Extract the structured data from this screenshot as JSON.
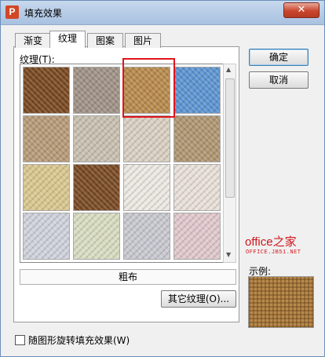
{
  "window": {
    "title": "填充效果",
    "close_glyph": "✕",
    "app_icon_letter": "P"
  },
  "tabs": [
    {
      "label": "渐变",
      "active": false
    },
    {
      "label": "纹理",
      "active": true
    },
    {
      "label": "图案",
      "active": false
    },
    {
      "label": "图片",
      "active": false
    }
  ],
  "texture_section": {
    "label": "纹理(T):",
    "selected_index": 2,
    "selected_name": "粗布",
    "textures": [
      {
        "name": "texture-brown-leather",
        "color": "#7a4a22"
      },
      {
        "name": "texture-fish-fossil",
        "color": "#a09286"
      },
      {
        "name": "texture-burlap",
        "color": "#b88a4c"
      },
      {
        "name": "texture-blue-tissue",
        "color": "#5d95d2"
      },
      {
        "name": "texture-paper-bag",
        "color": "#b79b78"
      },
      {
        "name": "texture-granite",
        "color": "#c8c0b0"
      },
      {
        "name": "texture-newsprint",
        "color": "#d9cfc2"
      },
      {
        "name": "texture-cork",
        "color": "#b09672"
      },
      {
        "name": "texture-sand",
        "color": "#d9c78f"
      },
      {
        "name": "texture-leopard",
        "color": "#7a4b25"
      },
      {
        "name": "texture-script-paper",
        "color": "#ece8e2"
      },
      {
        "name": "texture-canvas-stripes",
        "color": "#e8e0d8"
      },
      {
        "name": "texture-denim-stripes",
        "color": "#cfd2dc"
      },
      {
        "name": "texture-green-weave",
        "color": "#d8dcc0"
      },
      {
        "name": "texture-grey-weave",
        "color": "#c8c8d0"
      },
      {
        "name": "texture-pink-check",
        "color": "#e0c8cc"
      }
    ]
  },
  "buttons": {
    "ok": "确定",
    "cancel": "取消",
    "other_texture": "其它纹理(O)..."
  },
  "preview": {
    "label": "示例:"
  },
  "checkbox": {
    "label": "随图形旋转填充效果(W)",
    "checked": false
  },
  "watermark": {
    "brand": "office之家",
    "brand_url": "OFFICE.JB51.NET"
  }
}
